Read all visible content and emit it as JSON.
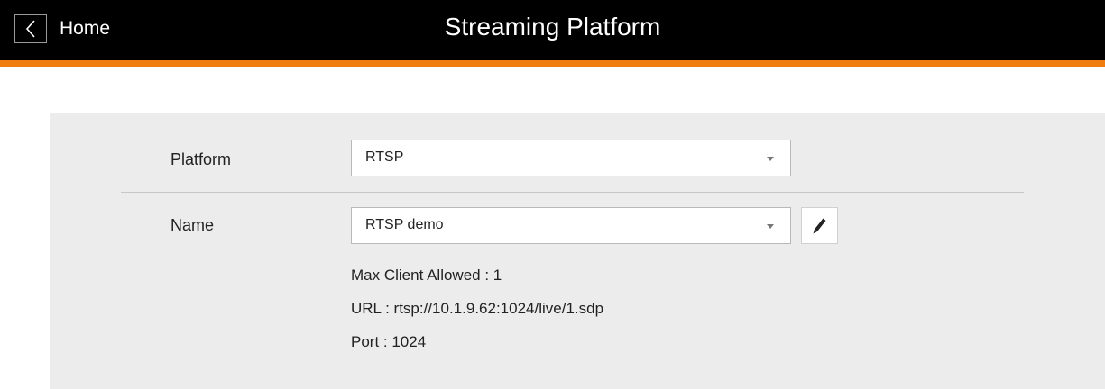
{
  "header": {
    "back_label": "Home",
    "title": "Streaming Platform",
    "accent_color": "#ef7d12"
  },
  "form": {
    "platform": {
      "label": "Platform",
      "value": "RTSP"
    },
    "name": {
      "label": "Name",
      "value": "RTSP demo"
    },
    "info": {
      "max_clients": "Max Client Allowed : 1",
      "url": "URL : rtsp://10.1.9.62:1024/live/1.sdp",
      "port": "Port : 1024"
    }
  },
  "icons": {
    "back": "chevron-left-icon",
    "caret": "caret-down-icon",
    "edit": "pencil-icon"
  }
}
